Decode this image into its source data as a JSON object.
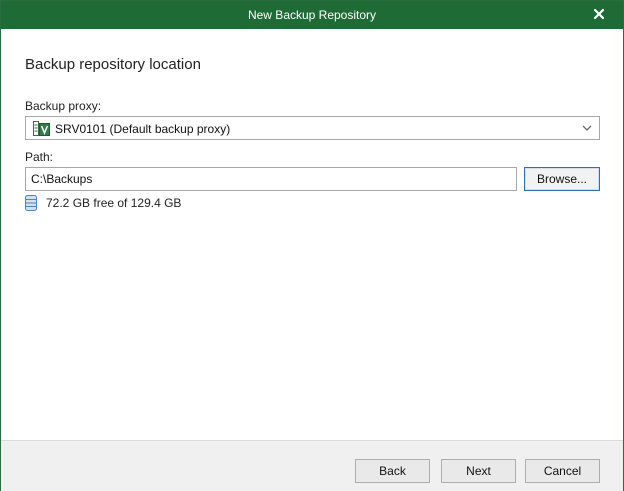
{
  "window": {
    "title": "New Backup Repository"
  },
  "main": {
    "heading": "Backup repository location",
    "proxy": {
      "label": "Backup proxy:",
      "selected": "SRV0101 (Default backup proxy)",
      "icon": "backup-proxy-server-icon"
    },
    "path": {
      "label": "Path:",
      "value": "C:\\Backups",
      "browse_label": "Browse..."
    },
    "space": {
      "icon": "database-icon",
      "text": "72.2 GB free of 129.4 GB"
    }
  },
  "footer": {
    "back_label": "Back",
    "next_label": "Next",
    "cancel_label": "Cancel"
  },
  "colors": {
    "titlebar": "#1e6b36",
    "focus_border": "#2f6fad"
  }
}
